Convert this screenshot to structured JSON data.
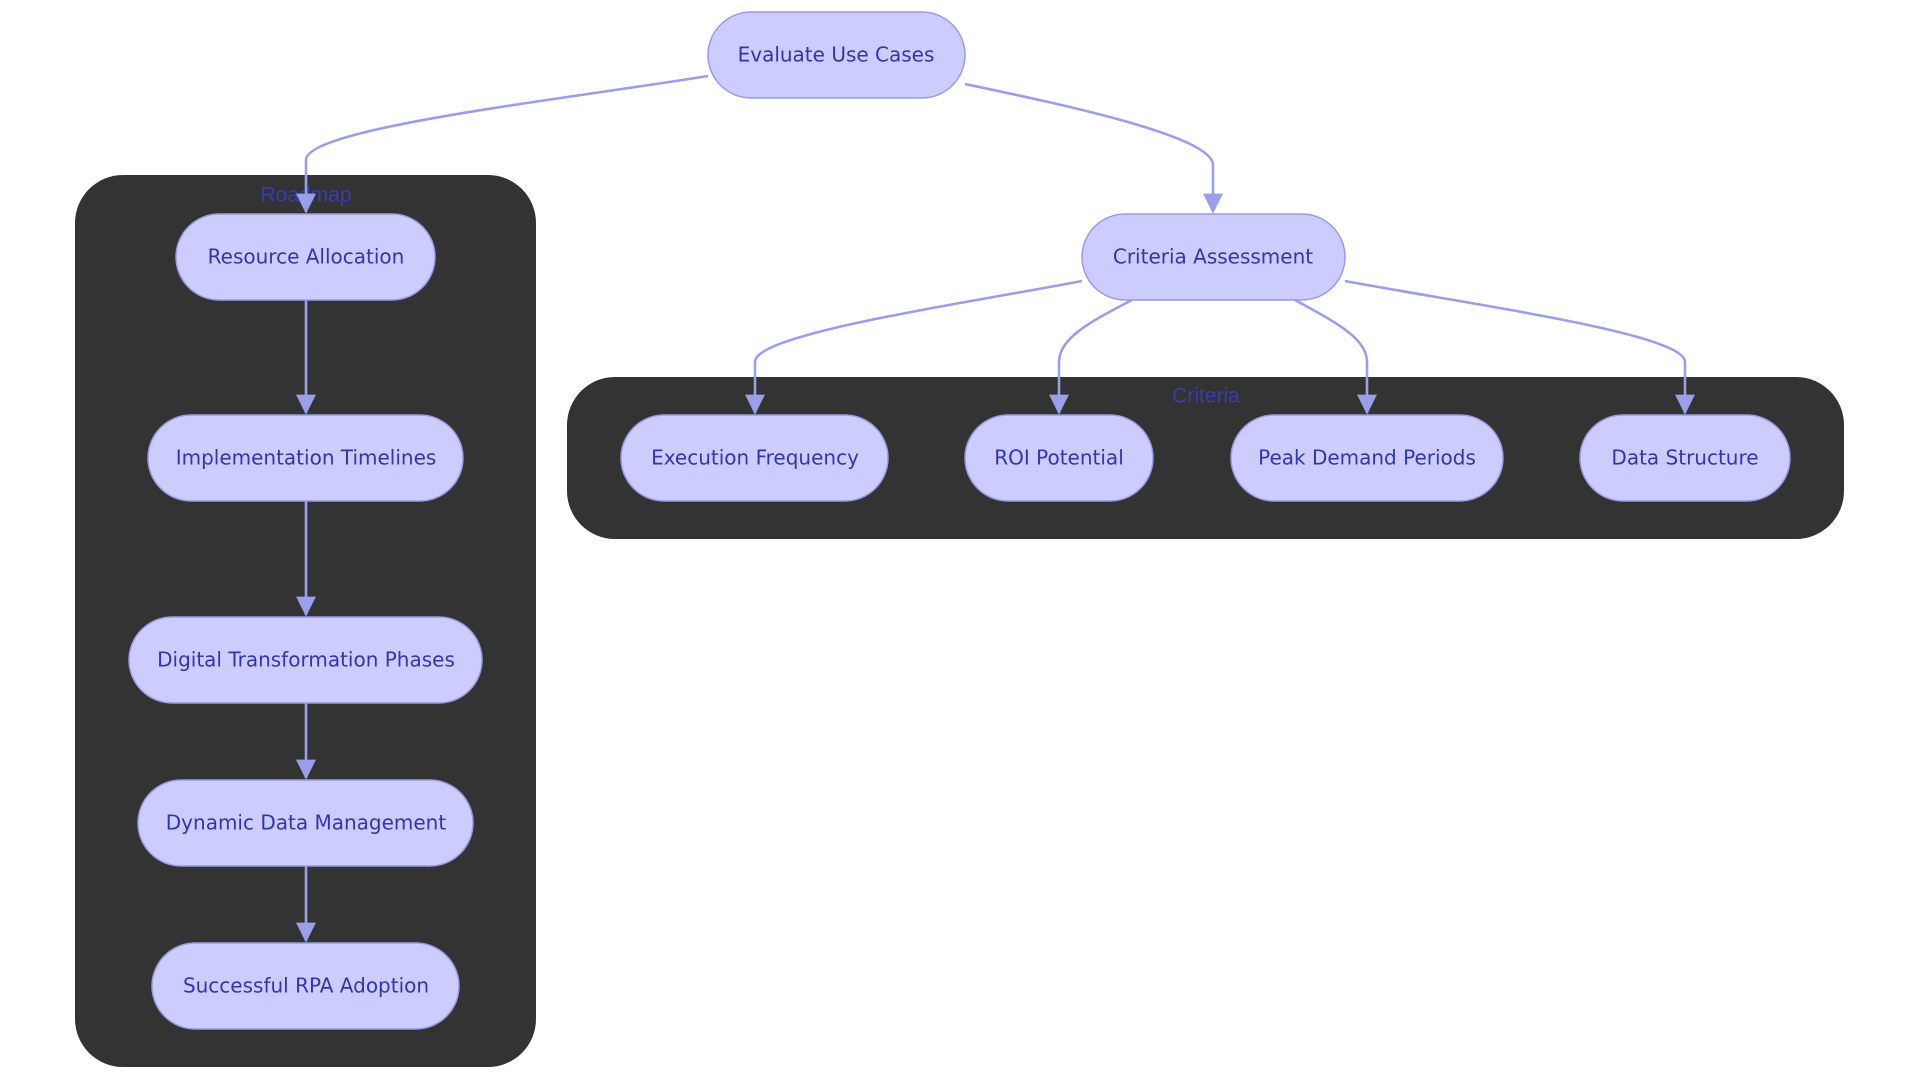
{
  "diagram": {
    "type": "flowchart",
    "colors": {
      "node_fill": "#ccccff",
      "node_border": "#9a9ae6",
      "node_text": "#3236a8",
      "edge": "#9b9ee8",
      "cluster_fill": "#333333",
      "cluster_label": "#3b3ec4",
      "background": "#ffffff"
    },
    "clusters": {
      "roadmap": {
        "label": "Roadmap"
      },
      "criteria": {
        "label": "Criteria"
      }
    },
    "nodes": {
      "evaluate": {
        "label": "Evaluate Use Cases"
      },
      "resource": {
        "label": "Resource Allocation"
      },
      "timelines": {
        "label": "Implementation Timelines"
      },
      "phases": {
        "label": "Digital Transformation Phases"
      },
      "datamgmt": {
        "label": "Dynamic Data Management"
      },
      "adoption": {
        "label": "Successful RPA Adoption"
      },
      "assessment": {
        "label": "Criteria Assessment"
      },
      "frequency": {
        "label": "Execution Frequency"
      },
      "roi": {
        "label": "ROI Potential"
      },
      "peak": {
        "label": "Peak Demand Periods"
      },
      "structure": {
        "label": "Data Structure"
      }
    },
    "edges": [
      {
        "from": "Evaluate Use Cases",
        "to": "Resource Allocation"
      },
      {
        "from": "Evaluate Use Cases",
        "to": "Criteria Assessment"
      },
      {
        "from": "Resource Allocation",
        "to": "Implementation Timelines"
      },
      {
        "from": "Implementation Timelines",
        "to": "Digital Transformation Phases"
      },
      {
        "from": "Digital Transformation Phases",
        "to": "Dynamic Data Management"
      },
      {
        "from": "Dynamic Data Management",
        "to": "Successful RPA Adoption"
      },
      {
        "from": "Criteria Assessment",
        "to": "Execution Frequency"
      },
      {
        "from": "Criteria Assessment",
        "to": "ROI Potential"
      },
      {
        "from": "Criteria Assessment",
        "to": "Peak Demand Periods"
      },
      {
        "from": "Criteria Assessment",
        "to": "Data Structure"
      }
    ]
  }
}
